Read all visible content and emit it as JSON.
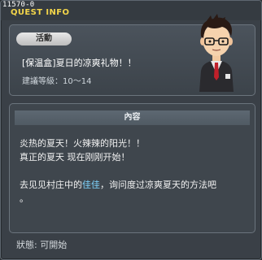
{
  "window": {
    "quest_id": "11570-0",
    "title": "QUEST INFO",
    "close_glyph": "×"
  },
  "header": {
    "category": "活動",
    "quest_title": "[保温盒]夏日的凉爽礼物！！",
    "recommend_level": "建議等級：10～14"
  },
  "content": {
    "header": "內容",
    "line1": "炎热的夏天！火辣辣的阳光！！",
    "line2": "真正的夏天 现在刚刚开始！",
    "line3_prefix": "去见见村庄中的",
    "npc_name": "佳佳",
    "line3_suffix": "，询问度过凉爽夏天的方法吧",
    "line4": "。"
  },
  "status": "狀態: 可開始",
  "icons": {
    "npc": "npc-portrait-icon",
    "close": "close-icon"
  },
  "colors": {
    "title": "#f3d54a",
    "npc_name": "#7fd6ff",
    "panel_bg": "#3a4047"
  }
}
